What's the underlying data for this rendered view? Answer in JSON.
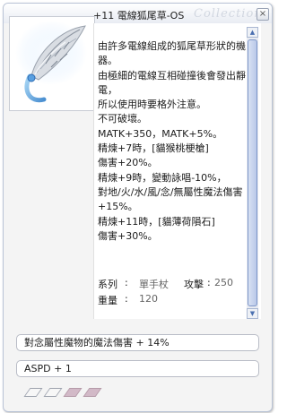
{
  "window": {
    "title": "+11 電線狐尾草-OS",
    "watermark": "Collections",
    "close_glyph": "×"
  },
  "item_image": {
    "icon": "electric-fox-tail-staff-icon",
    "alt": "電線狐尾草"
  },
  "description": {
    "text": "由許多電線組成的狐尾草形狀的機器。\n由極細的電線互相碰撞後會發出靜電，\n所以使用時要格外注意。\n不可破壞。\nMATK+350，MATK+5%。\n精煉+7時，[貓猴桃梗槍]\n傷害+20%。\n精煉+9時，變動詠唱-10%，\n對地/火/水/風/念/無屬性魔法傷害+15%。\n精煉+11時，[貓薄荷隕石]\n傷害+30%。"
  },
  "stats": {
    "series_label": "系列",
    "series_value": "單手杖",
    "attack_label": "攻擊",
    "attack_value": "250",
    "weight_label": "重量",
    "weight_value": "120"
  },
  "scrollbar": {
    "up_glyph": "▲",
    "down_glyph": "▼"
  },
  "random_options": [
    "對念屬性魔物的魔法傷害 + 14%",
    "ASPD + 1"
  ],
  "card_slots": [
    {
      "state": "empty"
    },
    {
      "state": "empty"
    },
    {
      "state": "filled"
    },
    {
      "state": "filled"
    }
  ]
}
